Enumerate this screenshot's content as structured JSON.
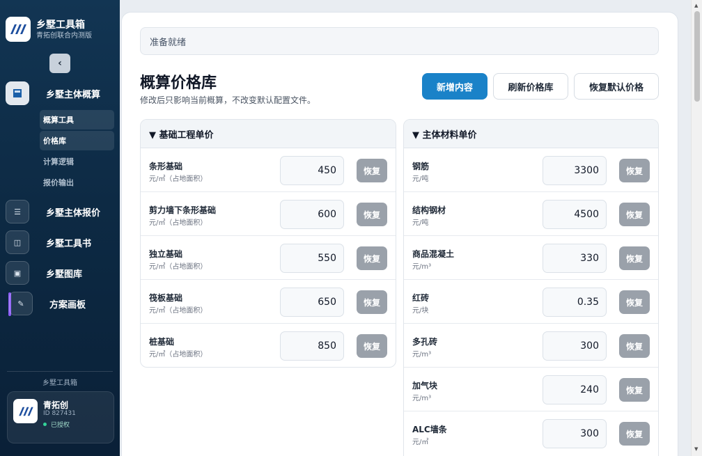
{
  "sidebar": {
    "brand_title": "乡墅工具箱",
    "brand_subtitle": "青拓创联合内测版",
    "collapse_icon": "‹",
    "nav": [
      {
        "label": "乡墅主体概算",
        "icon": "calculator-icon",
        "glyph": "▦"
      },
      {
        "label": "乡墅主体报价",
        "icon": "list-icon",
        "glyph": "☰"
      },
      {
        "label": "乡墅工具书",
        "icon": "book-icon",
        "glyph": "◫"
      },
      {
        "label": "乡墅图库",
        "icon": "image-icon",
        "glyph": "▣"
      },
      {
        "label": "方案画板",
        "icon": "pencil-icon",
        "glyph": "✎"
      }
    ],
    "subnav": [
      "概算工具",
      "价格库",
      "计算逻辑",
      "报价输出"
    ],
    "footer_label": "乡墅工具箱",
    "user": {
      "name": "青拓创",
      "id": "ID 827431",
      "status": "已授权"
    }
  },
  "main": {
    "status": "准备就绪",
    "title": "概算价格库",
    "subtitle": "修改后只影响当前概算，不改变默认配置文件。",
    "buttons": {
      "add": "新增内容",
      "refresh": "刷新价格库",
      "reset_all": "恢复默认价格"
    },
    "reset_label": "恢复",
    "left_section": {
      "title": "▼ 基础工程单价",
      "rows": [
        {
          "name": "条形基础",
          "unit": "元/㎡（占地面积）",
          "value": "450"
        },
        {
          "name": "剪力墙下条形基础",
          "unit": "元/㎡（占地面积）",
          "value": "600"
        },
        {
          "name": "独立基础",
          "unit": "元/㎡（占地面积）",
          "value": "550"
        },
        {
          "name": "筏板基础",
          "unit": "元/㎡（占地面积）",
          "value": "650"
        },
        {
          "name": "桩基础",
          "unit": "元/㎡（占地面积）",
          "value": "850"
        }
      ]
    },
    "right_section": {
      "title": "▼ 主体材料单价",
      "rows": [
        {
          "name": "钢筋",
          "unit": "元/吨",
          "value": "3300"
        },
        {
          "name": "结构钢材",
          "unit": "元/吨",
          "value": "4500"
        },
        {
          "name": "商品混凝土",
          "unit": "元/m³",
          "value": "330"
        },
        {
          "name": "红砖",
          "unit": "元/块",
          "value": "0.35"
        },
        {
          "name": "多孔砖",
          "unit": "元/m³",
          "value": "300"
        },
        {
          "name": "加气块",
          "unit": "元/m³",
          "value": "240"
        },
        {
          "name": "ALC墙条",
          "unit": "元/㎡",
          "value": "300"
        }
      ]
    }
  },
  "colors": {
    "primary": "#1a82c8",
    "sidebar": "#0d2a44",
    "reset_button": "#9aa1aa"
  }
}
